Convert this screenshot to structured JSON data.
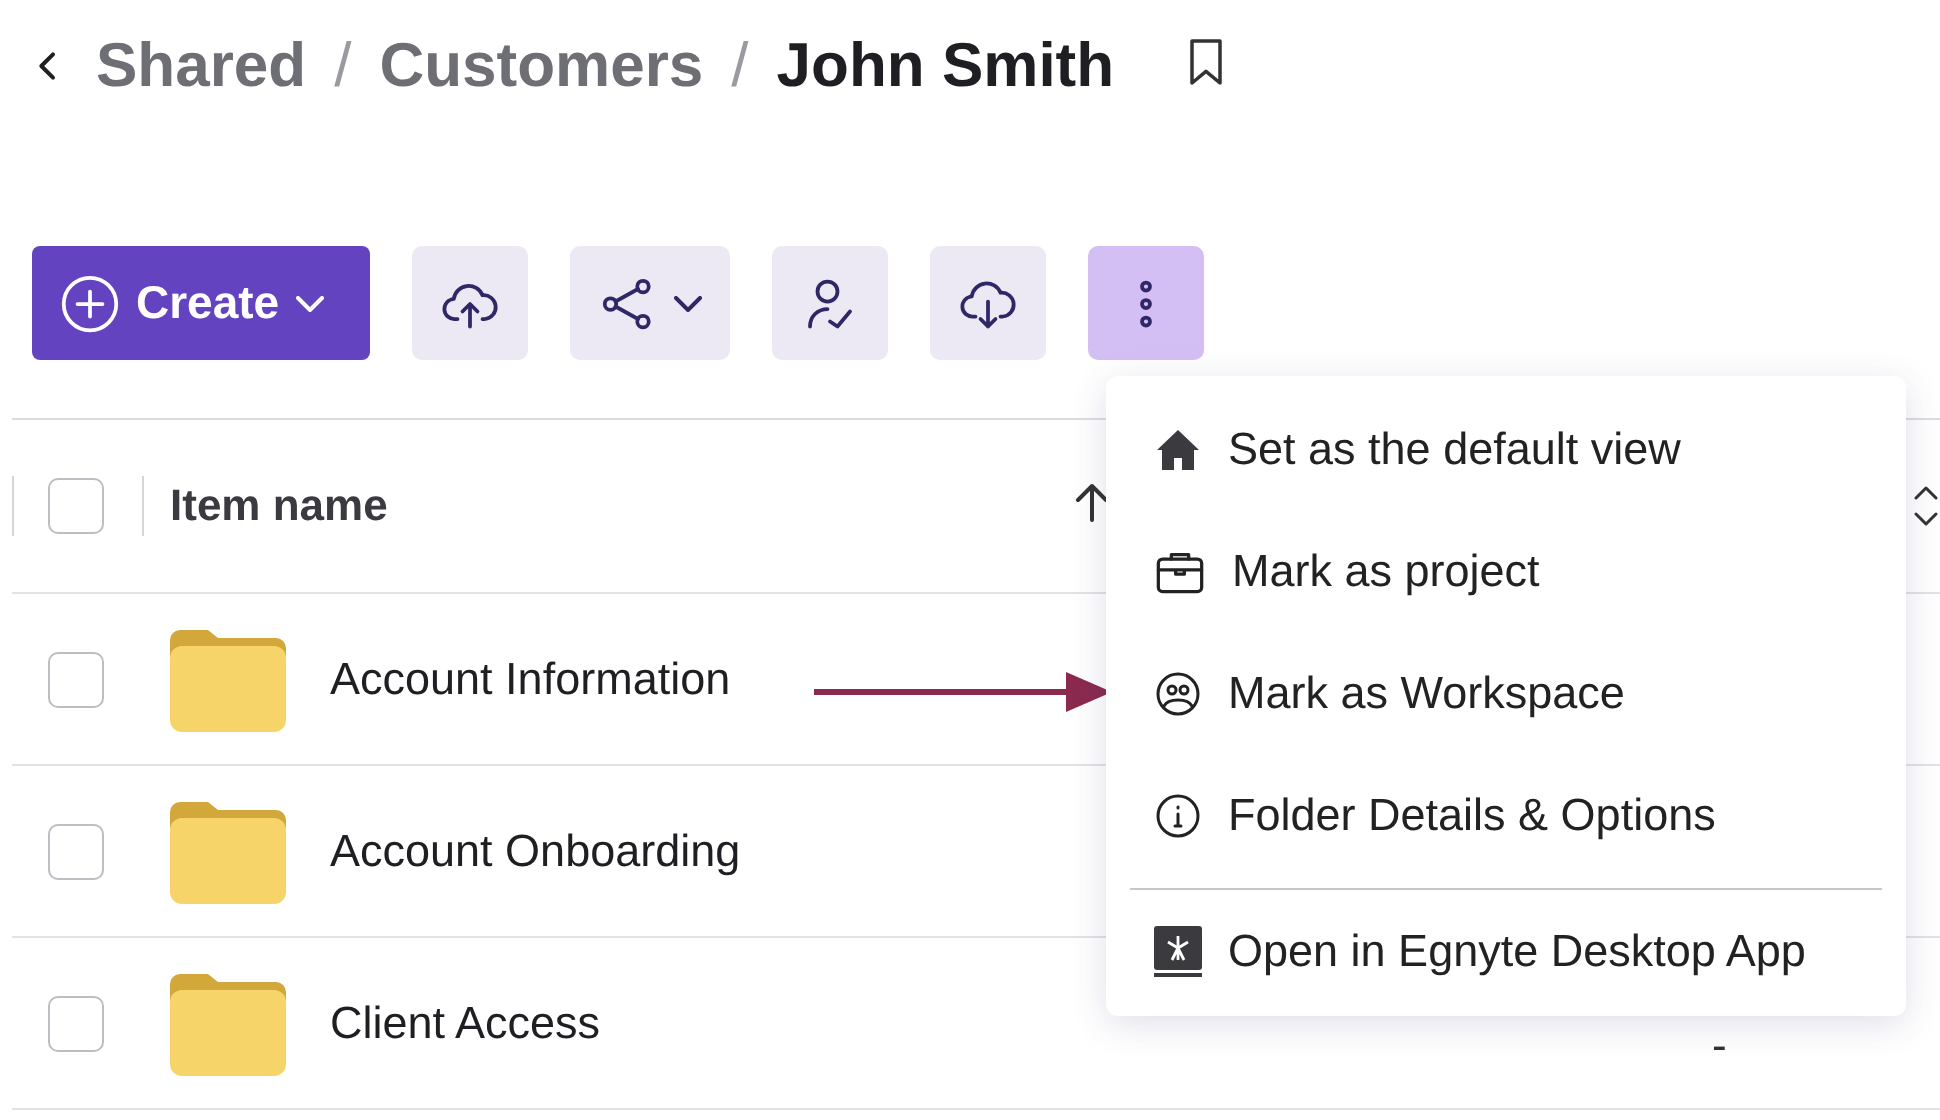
{
  "breadcrumb": {
    "items": [
      {
        "label": "Shared",
        "current": false
      },
      {
        "label": "Customers",
        "current": false
      },
      {
        "label": "John Smith",
        "current": true
      }
    ],
    "separator": "/"
  },
  "toolbar": {
    "create": {
      "label": "Create"
    },
    "buttons": [
      {
        "kind": "upload",
        "active": false
      },
      {
        "kind": "share",
        "active": false
      },
      {
        "kind": "assign",
        "active": false
      },
      {
        "kind": "download",
        "active": false
      },
      {
        "kind": "more",
        "active": true
      }
    ]
  },
  "table": {
    "header": {
      "label": "Item name",
      "checked": false
    },
    "rows": [
      {
        "name": "Account Information",
        "checked": false
      },
      {
        "name": "Account Onboarding",
        "checked": false
      },
      {
        "name": "Client Access",
        "checked": false,
        "column_2": "-"
      }
    ]
  },
  "menu": {
    "items": [
      {
        "kind": "home",
        "label": "Set as the default view",
        "separator_before": false
      },
      {
        "kind": "project",
        "label": "Mark as project",
        "separator_before": false
      },
      {
        "kind": "workspace",
        "label": "Mark as Workspace",
        "separator_before": false
      },
      {
        "kind": "info",
        "label": "Folder Details & Options",
        "separator_before": false
      },
      {
        "kind": "desktop",
        "label": "Open in Egnyte Desktop App",
        "separator_before": true
      }
    ]
  }
}
